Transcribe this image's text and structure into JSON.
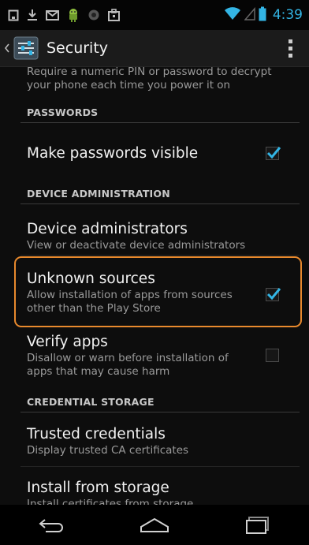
{
  "status_bar": {
    "time": "4:39",
    "left_icons": [
      "notification-square-icon",
      "download-icon",
      "gmail-icon",
      "android-icon",
      "sync-icon",
      "briefcase-icon"
    ],
    "right_icons": [
      "wifi-icon",
      "signal-icon",
      "battery-icon"
    ],
    "accent_color": "#33b5e5"
  },
  "action_bar": {
    "title": "Security",
    "icon": "settings-sliders-icon"
  },
  "top_partial": {
    "summary": "Require a numeric PIN or password to decrypt your phone each time you power it on"
  },
  "sections": {
    "passwords": {
      "header": "PASSWORDS",
      "items": [
        {
          "title": "Make passwords visible",
          "checked": true
        }
      ]
    },
    "device_admin": {
      "header": "DEVICE ADMINISTRATION",
      "items": [
        {
          "title": "Device administrators",
          "summary": "View or deactivate device administrators"
        },
        {
          "title": "Unknown sources",
          "summary": "Allow installation of apps from sources other than the Play Store",
          "checked": true,
          "highlighted": true
        },
        {
          "title": "Verify apps",
          "summary": "Disallow or warn before installation of apps that may cause harm",
          "checked": false
        }
      ]
    },
    "credential_storage": {
      "header": "CREDENTIAL STORAGE",
      "items": [
        {
          "title": "Trusted credentials",
          "summary": "Display trusted CA certificates"
        },
        {
          "title": "Install from storage",
          "summary": "Install certificates from storage"
        }
      ]
    }
  },
  "nav_bar": {
    "buttons": [
      "back-icon",
      "home-icon",
      "recents-icon"
    ]
  },
  "colors": {
    "checkbox_accent": "#33b5e5",
    "highlight_border": "#e8892d"
  }
}
